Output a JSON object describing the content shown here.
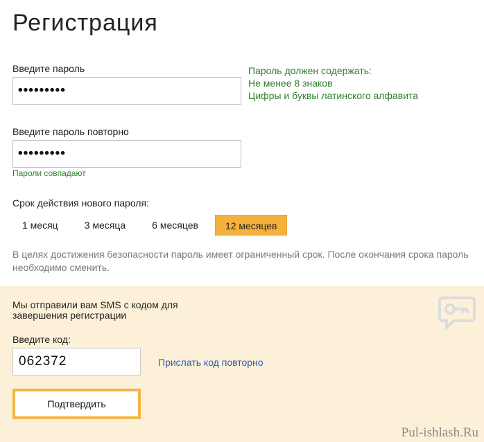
{
  "page_title": "Регистрация",
  "password": {
    "label": "Введите пароль",
    "value_masked": "•••••••••"
  },
  "password_repeat": {
    "label": "Введите пароль повторно",
    "value_masked": "•••••••••",
    "status": "Пароли совпадают"
  },
  "password_hint": {
    "title": "Пароль должен содержать:",
    "items": [
      "Не менее 8 знаков",
      "Цифры и буквы латинского алфавита"
    ]
  },
  "validity": {
    "label": "Срок действия нового пароля:",
    "options": [
      "1 месяц",
      "3 месяца",
      "6 месяцев",
      "12 месяцев"
    ],
    "selected": "12 месяцев",
    "note": "В целях достижения безопасности пароль имеет ограниченный срок. После окончания срока пароль необходимо сменить."
  },
  "sms": {
    "message_line1": "Мы отправили вам SMS с кодом для",
    "message_line2": "завершения регистрации",
    "code_label": "Введите код:",
    "code_value": "062372",
    "resend_link": "Прислать код повторно",
    "confirm_button": "Подтвердить",
    "icon": "key-message-icon"
  },
  "watermark": "Pul-ishlash.Ru",
  "colors": {
    "accent": "#f6b03e",
    "success_text": "#2f7f2f",
    "link": "#2a5db0",
    "sms_panel_bg": "#fcf1d8"
  }
}
